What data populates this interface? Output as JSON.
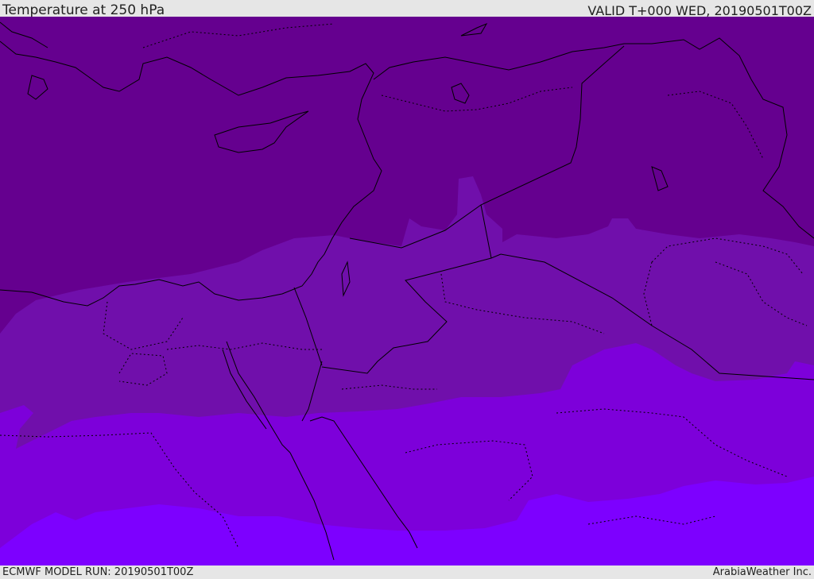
{
  "header": {
    "title": "Temperature at 250 hPa",
    "valid": "VALID T+000 WED, 20190501T00Z"
  },
  "footer": {
    "model_run": "ECMWF MODEL RUN: 20190501T00Z",
    "credit": "ArabiaWeather Inc."
  },
  "colors": {
    "band_coldest": "#65008f",
    "band_cold": "#700fab",
    "band_mid": "#7d00da",
    "band_warm": "#7d00ff",
    "coastline": "#000000",
    "border": "#000000"
  }
}
